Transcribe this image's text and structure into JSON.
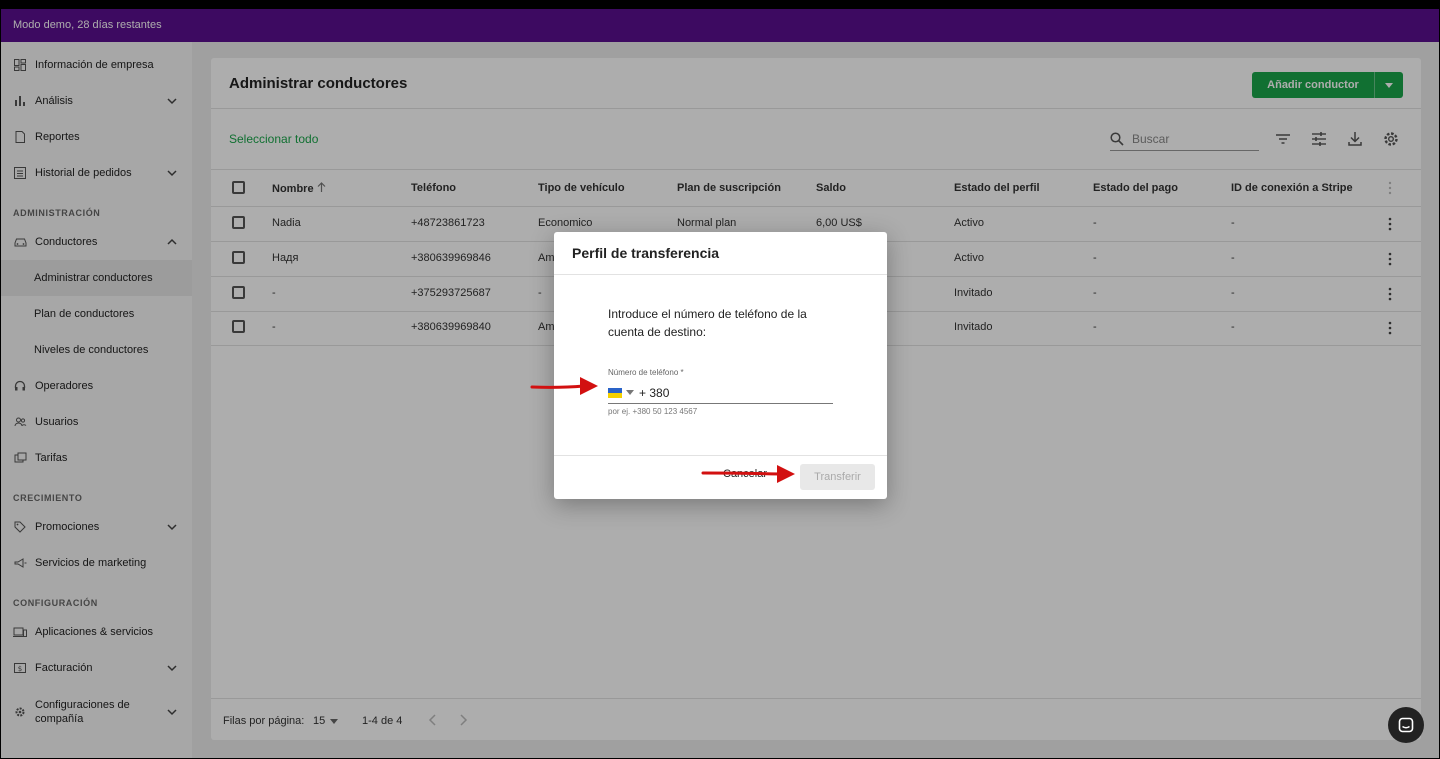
{
  "demo_banner": "Modo demo, 28 días restantes",
  "sidebar": {
    "items": [
      {
        "label": "Información de empresa",
        "icon": "dashboard-icon"
      },
      {
        "label": "Análisis",
        "icon": "bar-chart-icon",
        "expandable": true
      },
      {
        "label": "Reportes",
        "icon": "document-icon"
      },
      {
        "label": "Historial de pedidos",
        "icon": "list-icon",
        "expandable": true
      }
    ],
    "section_admin": "ADMINISTRACIÓN",
    "admin_items": [
      {
        "label": "Conductores",
        "icon": "car-icon",
        "expanded": true
      },
      {
        "label": "Administrar conductores",
        "active": true
      },
      {
        "label": "Plan de conductores"
      },
      {
        "label": "Niveles de conductores"
      },
      {
        "label": "Operadores",
        "icon": "headset-icon"
      },
      {
        "label": "Usuarios",
        "icon": "users-icon"
      },
      {
        "label": "Tarifas",
        "icon": "tag-icon"
      }
    ],
    "section_growth": "CRECIMIENTO",
    "growth_items": [
      {
        "label": "Promociones",
        "icon": "promo-icon",
        "expandable": true
      },
      {
        "label": "Servicios de marketing",
        "icon": "megaphone-icon"
      }
    ],
    "section_config": "CONFIGURACIÓN",
    "config_items": [
      {
        "label": "Aplicaciones & servicios",
        "icon": "devices-icon"
      },
      {
        "label": "Facturación",
        "icon": "billing-icon",
        "expandable": true
      },
      {
        "label": "Configuraciones de compañía",
        "icon": "gear-icon",
        "expandable": true
      }
    ]
  },
  "page": {
    "title": "Administrar conductores",
    "add_button": "Añadir conductor",
    "select_all": "Seleccionar todo",
    "search_placeholder": "Buscar"
  },
  "table": {
    "headers": [
      "Nombre",
      "Teléfono",
      "Tipo de vehículo",
      "Plan de suscripción",
      "Saldo",
      "Estado del perfil",
      "Estado del pago",
      "ID de conexión a Stripe"
    ],
    "rows": [
      [
        "Nadia",
        "+48723861723",
        "Economico",
        "Normal plan",
        "6,00 US$",
        "Activo",
        "-",
        "-"
      ],
      [
        "Надя",
        "+380639969846",
        "Am",
        "",
        "",
        "Activo",
        "-",
        "-"
      ],
      [
        "-",
        "+375293725687",
        "-",
        "",
        "",
        "Invitado",
        "-",
        "-"
      ],
      [
        "-",
        "+380639969840",
        "Am",
        "",
        "",
        "Invitado",
        "-",
        "-"
      ]
    ]
  },
  "footer": {
    "rows_per_page_label": "Filas por página:",
    "rows_per_page_value": "15",
    "range": "1-4 de 4"
  },
  "dialog": {
    "title": "Perfil de transferencia",
    "instruction": "Introduce el número de teléfono de la cuenta de destino:",
    "phone_label": "Número de teléfono *",
    "phone_value": "+ 380",
    "phone_hint": "por ej. +380 50 123 4567",
    "cancel": "Cancelar",
    "transfer": "Transferir"
  },
  "colors": {
    "accent": "#1aa64a",
    "banner": "#5b0f8f",
    "annotation_arrow": "#e01010"
  }
}
